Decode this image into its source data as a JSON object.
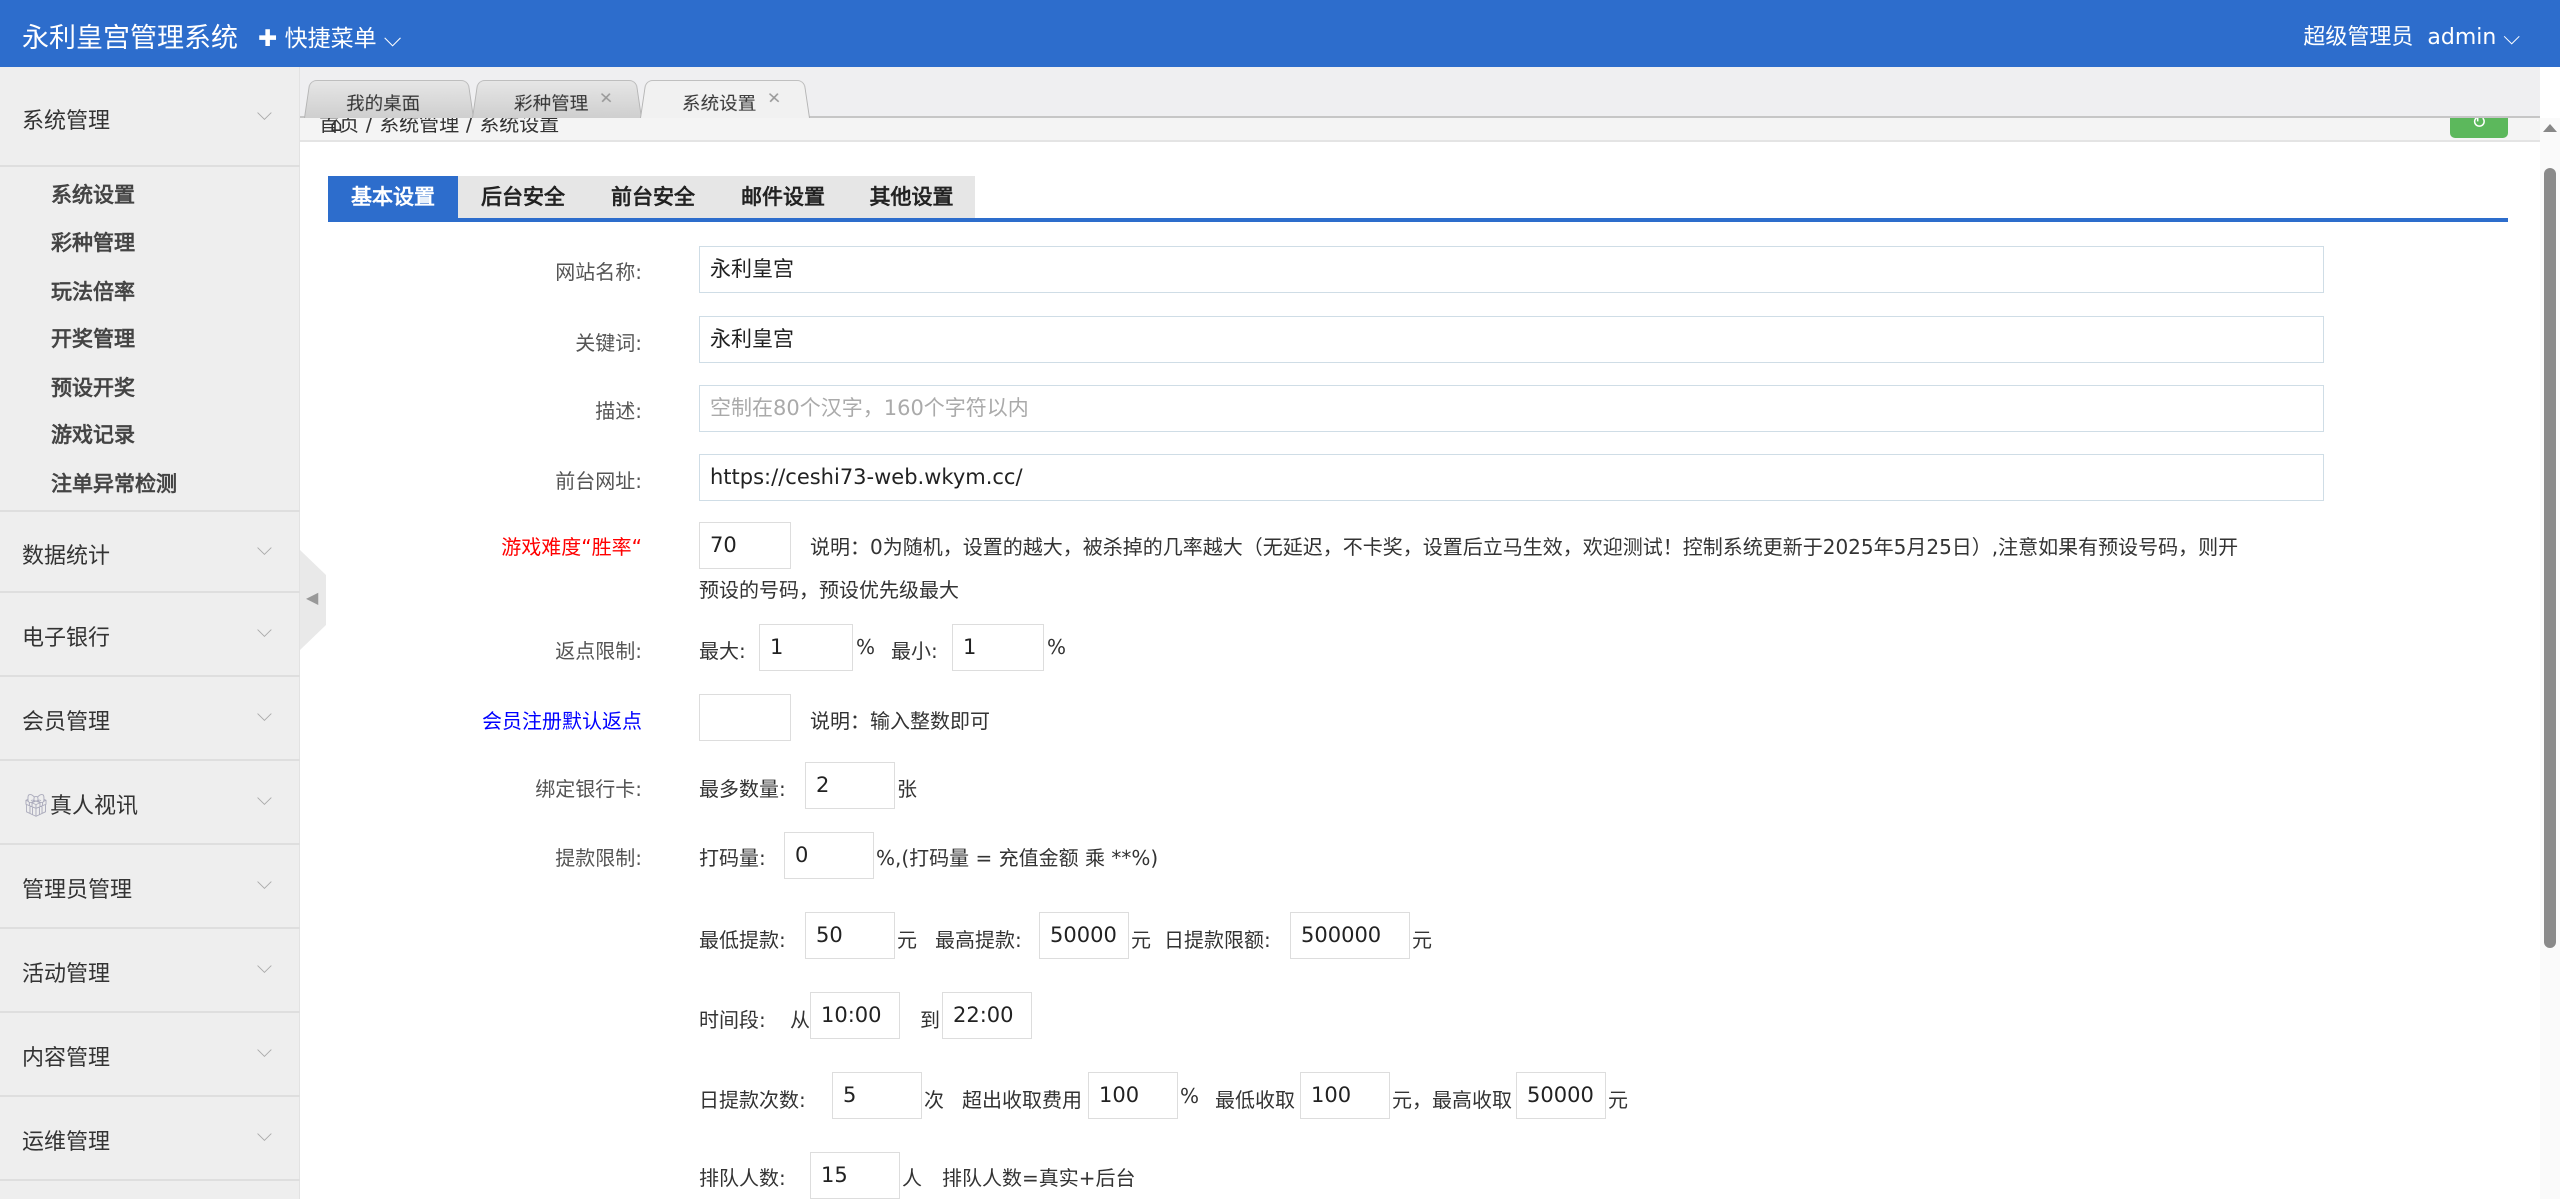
{
  "header": {
    "title": "永利皇宫管理系统",
    "quick_menu": "快捷菜单",
    "role": "超级管理员",
    "user": "admin"
  },
  "sidebar": {
    "group0": "系统管理",
    "subitems": [
      "系统设置",
      "彩种管理",
      "玩法倍率",
      "开奖管理",
      "预设开奖",
      "游戏记录",
      "注单异常检测"
    ],
    "groups": [
      "数据统计",
      "电子银行",
      "会员管理",
      "真人视讯",
      "管理员管理",
      "活动管理",
      "内容管理",
      "运维管理"
    ]
  },
  "page_tabs": [
    {
      "label": "我的桌面"
    },
    {
      "label": "彩种管理"
    },
    {
      "label": "系统设置"
    }
  ],
  "breadcrumb": {
    "home": "首页",
    "sep": "/",
    "level1": "系统管理",
    "level2": "系统设置"
  },
  "settings_tabs": [
    "基本设置",
    "后台安全",
    "前台安全",
    "邮件设置",
    "其他设置"
  ],
  "colors": {
    "brand": "#2d6dcc",
    "sidebar": "#eeeeee",
    "refresh": "#5cb85c",
    "warn": "#ff0000",
    "link": "#0000ff"
  },
  "form": {
    "site_name": {
      "label": "网站名称:",
      "value": "永利皇宫"
    },
    "keywords": {
      "label": "关键词:",
      "value": "永利皇宫"
    },
    "description": {
      "label": "描述:",
      "placeholder": "空制在80个汉字，160个字符以内"
    },
    "frontend_url": {
      "label": "前台网址:",
      "value": "https://ceshi73-web.wkym.cc/"
    },
    "difficulty": {
      "label": "游戏难度“胜率“",
      "value": "70",
      "note1": "说明：0为随机，设置的越大，被杀掉的几率越大（无延迟，不卡奖，设置后立马生效，欢迎测试！控制系统更新于2025年5月25日）,注意如果有预设号码，则开",
      "note2": "预设的号码，预设优先级最大"
    },
    "rebate": {
      "label": "返点限制:",
      "max_label": "最大:",
      "max": "1",
      "min_label": "最小:",
      "min": "1",
      "unit": "%"
    },
    "reg_rebate": {
      "label": "会员注册默认返点",
      "value": "",
      "note": "说明：输入整数即可"
    },
    "bank": {
      "label": "绑定银行卡:",
      "max_label": "最多数量:",
      "value": "2",
      "unit": "张"
    },
    "withdraw": {
      "label": "提款限制:",
      "bet_label": "打码量:",
      "bet": "0",
      "bet_note": "%,(打码量 = 充值金额 乘 **%)",
      "min_label": "最低提款:",
      "min": "50",
      "yuan": "元",
      "max_label": "最高提款:",
      "max": "50000",
      "daily_label": "日提款限额:",
      "daily": "500000",
      "time_label": "时间段:",
      "from": "从",
      "start": "10:00",
      "to": "到",
      "end": "22:00",
      "count_label": "日提款次数:",
      "count": "5",
      "times": "次",
      "fee_label": "超出收取费用",
      "fee": "100",
      "pct": "%",
      "low_label": "最低收取",
      "low": "100",
      "high_label": "元，最高收取",
      "high": "50000",
      "queue_label": "排队人数:",
      "queue": "15",
      "person": "人",
      "queue_note": "排队人数=真实+后台"
    }
  }
}
